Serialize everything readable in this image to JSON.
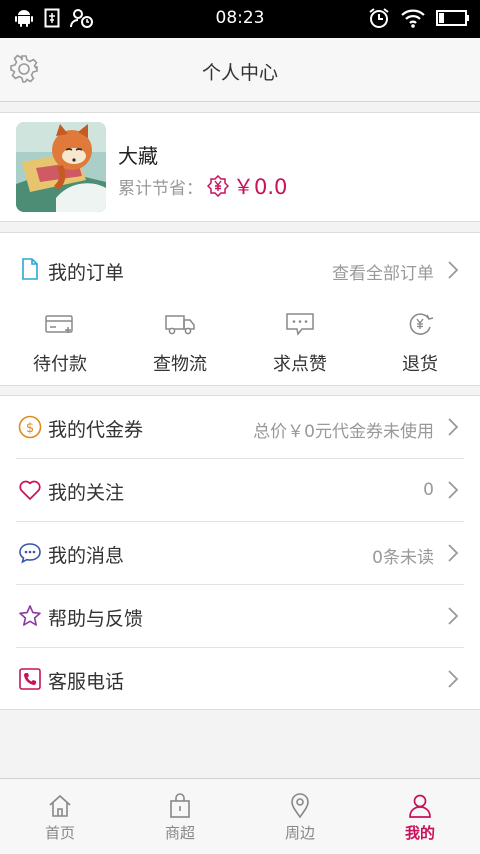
{
  "status_bar": {
    "time": "08:23"
  },
  "nav": {
    "title": "个人中心",
    "settings_icon": "gear-icon"
  },
  "profile": {
    "name": "大藏",
    "saved_label": "累计节省：",
    "saved_value": "￥0.0",
    "saved_icon": "yen-badge-icon"
  },
  "orders": {
    "label": "我的订单",
    "view_all": "查看全部订单",
    "tabs": [
      {
        "label": "待付款",
        "icon": "card-icon"
      },
      {
        "label": "查物流",
        "icon": "truck-icon"
      },
      {
        "label": "求点赞",
        "icon": "chat-bubble-icon"
      },
      {
        "label": "退货",
        "icon": "yen-refund-icon"
      }
    ]
  },
  "menu": [
    {
      "label": "我的代金券",
      "value": "总价￥0元代金券未使用",
      "icon": "coupon-icon"
    },
    {
      "label": "我的关注",
      "value": "0",
      "icon": "heart-icon"
    },
    {
      "label": "我的消息",
      "value": "0条未读",
      "icon": "message-icon"
    },
    {
      "label": "帮助与反馈",
      "value": "",
      "icon": "star-icon"
    },
    {
      "label": "客服电话",
      "value": "",
      "icon": "phone-icon"
    }
  ],
  "tab_bar": {
    "active": "我的",
    "items": [
      {
        "label": "首页",
        "icon": "home-icon"
      },
      {
        "label": "商超",
        "icon": "shopping-bag-icon"
      },
      {
        "label": "周边",
        "icon": "location-pin-icon"
      },
      {
        "label": "我的",
        "icon": "user-icon"
      }
    ]
  },
  "colors": {
    "accent": "#c8125a",
    "coupon": "#e08a1e",
    "message": "#3a55a8"
  }
}
